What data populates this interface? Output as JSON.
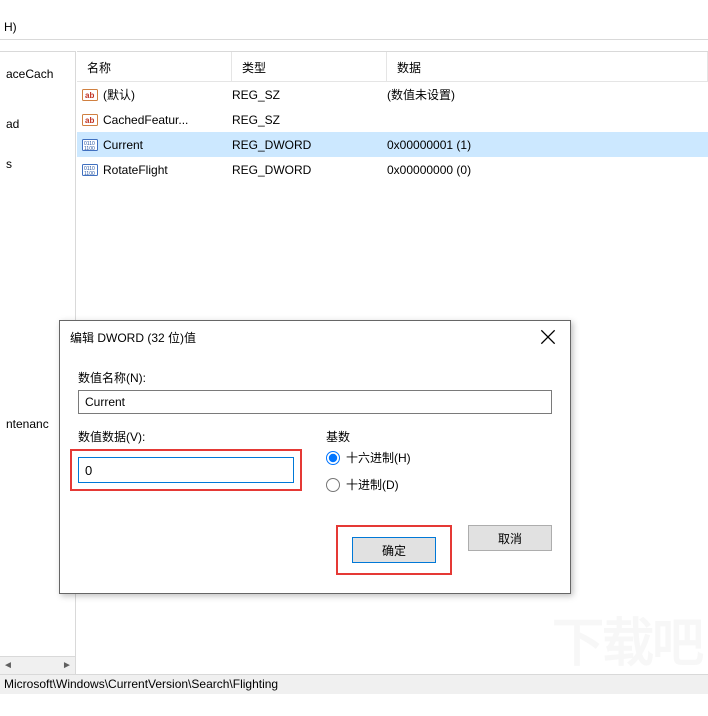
{
  "menubar": {
    "help_key": "H)"
  },
  "list": {
    "headers": {
      "name": "名称",
      "type": "类型",
      "data": "数据"
    },
    "rows": [
      {
        "icon": "ab",
        "name": "(默认)",
        "type": "REG_SZ",
        "data": "(数值未设置)",
        "selected": false
      },
      {
        "icon": "ab",
        "name": "CachedFeatur...",
        "type": "REG_SZ",
        "data": "",
        "selected": false
      },
      {
        "icon": "bin",
        "name": "Current",
        "type": "REG_DWORD",
        "data": "0x00000001 (1)",
        "selected": true
      },
      {
        "icon": "bin",
        "name": "RotateFlight",
        "type": "REG_DWORD",
        "data": "0x00000000 (0)",
        "selected": false
      }
    ]
  },
  "tree": {
    "items": [
      "",
      "",
      "aceCach",
      "",
      "ad",
      "",
      "s",
      "",
      "",
      "",
      "",
      "",
      "",
      "",
      "",
      "",
      "ntenanc"
    ]
  },
  "statusbar": {
    "path": "Microsoft\\Windows\\CurrentVersion\\Search\\Flighting"
  },
  "dialog": {
    "title": "编辑 DWORD (32 位)值",
    "name_label": "数值名称(N):",
    "name_value": "Current",
    "value_label": "数值数据(V):",
    "value_data": "0",
    "base_label": "基数",
    "radio_hex": "十六进制(H)",
    "radio_dec": "十进制(D)",
    "base_selected": "hex",
    "ok": "确定",
    "cancel": "取消"
  },
  "watermark": "下载吧"
}
